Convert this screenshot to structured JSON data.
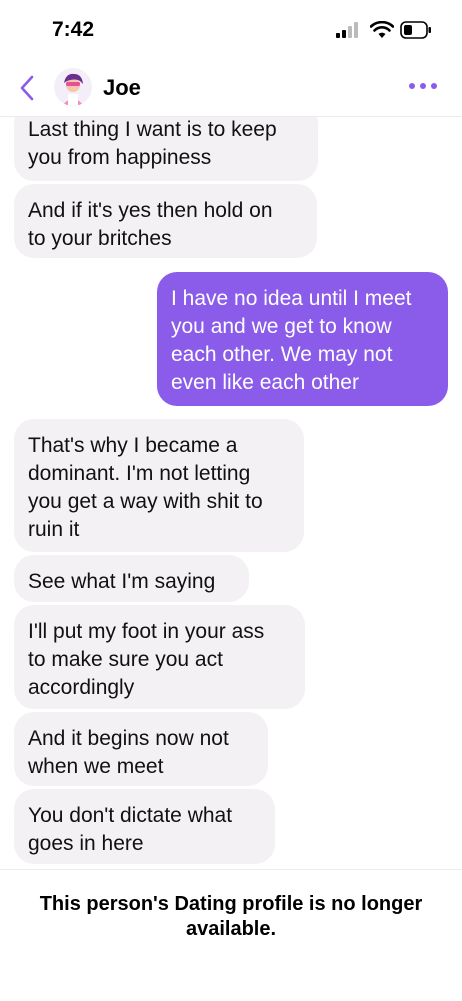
{
  "status_bar": {
    "time": "7:42",
    "icons": [
      "signal-icon",
      "wifi-icon",
      "battery-icon"
    ]
  },
  "header": {
    "back_icon": "chevron-left-icon",
    "contact_name": "Joe",
    "more_icon": "ellipsis-icon"
  },
  "colors": {
    "accent": "#8a5ce9",
    "incoming_bubble": "#f4f1f4",
    "outgoing_text": "#ffffff"
  },
  "messages": [
    {
      "direction": "incoming",
      "text": "Last thing I want is to keep\nyou from happiness"
    },
    {
      "direction": "incoming",
      "text": "And if it's yes then hold on\nto your britches"
    },
    {
      "direction": "outgoing",
      "text": "I have no idea until I meet\nyou and we get to know\neach other. We may not\neven like each other"
    },
    {
      "direction": "incoming",
      "text": "That's why I became a\ndominant. I'm not letting\nyou get a way with shit to\nruin it"
    },
    {
      "direction": "incoming",
      "text": "See what I'm saying"
    },
    {
      "direction": "incoming",
      "text": "I'll put my foot in your ass\nto make sure you act\naccordingly"
    },
    {
      "direction": "incoming",
      "text": "And it begins now not\nwhen we meet"
    },
    {
      "direction": "incoming",
      "text": "You don't dictate what\ngoes in here"
    }
  ],
  "footer": {
    "notice": "This person's Dating profile is no longer available."
  }
}
